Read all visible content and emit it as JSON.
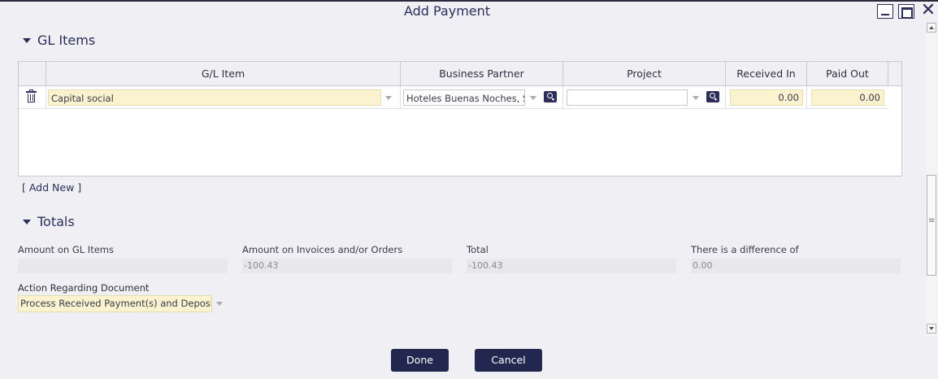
{
  "dialog": {
    "title": "Add Payment"
  },
  "gl_items": {
    "section_title": "GL Items",
    "columns": [
      "G/L Item",
      "Business Partner",
      "Project",
      "Received In",
      "Paid Out"
    ],
    "rows": [
      {
        "gl_item": "Capital social",
        "business_partner": "Hoteles Buenas Noches, S.",
        "project": "",
        "received_in": "0.00",
        "paid_out": "0.00"
      }
    ],
    "add_new_label": "[ Add New ]"
  },
  "totals": {
    "section_title": "Totals",
    "amount_gl_label": "Amount on GL Items",
    "amount_gl_value": "",
    "amount_invoices_label": "Amount on Invoices and/or Orders",
    "amount_invoices_value": "-100.43",
    "total_label": "Total",
    "total_value": "-100.43",
    "difference_label": "There is a difference of",
    "difference_value": "0.00",
    "action_label": "Action Regarding Document",
    "action_value": "Process Received Payment(s) and Deposit"
  },
  "buttons": {
    "done": "Done",
    "cancel": "Cancel"
  },
  "colors": {
    "accent": "#222750",
    "field_yellow": "#fbf3d0",
    "background": "#efeff4"
  }
}
